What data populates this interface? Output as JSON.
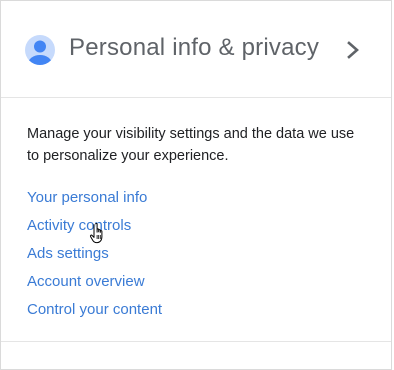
{
  "card": {
    "title": "Personal info & privacy",
    "description": "Manage your visibility settings and the data we use to personalize your experience.",
    "links": [
      {
        "label": "Your personal info"
      },
      {
        "label": "Activity controls"
      },
      {
        "label": "Ads settings"
      },
      {
        "label": "Account overview"
      },
      {
        "label": "Control your content"
      }
    ],
    "icons": {
      "avatar": "person-circle-icon",
      "chevron": "chevron-right-icon",
      "cursor": "hand-pointer-cursor"
    }
  },
  "colors": {
    "link": "#3a7bd5",
    "title": "#5f6368",
    "avatar": "#4285f4"
  }
}
